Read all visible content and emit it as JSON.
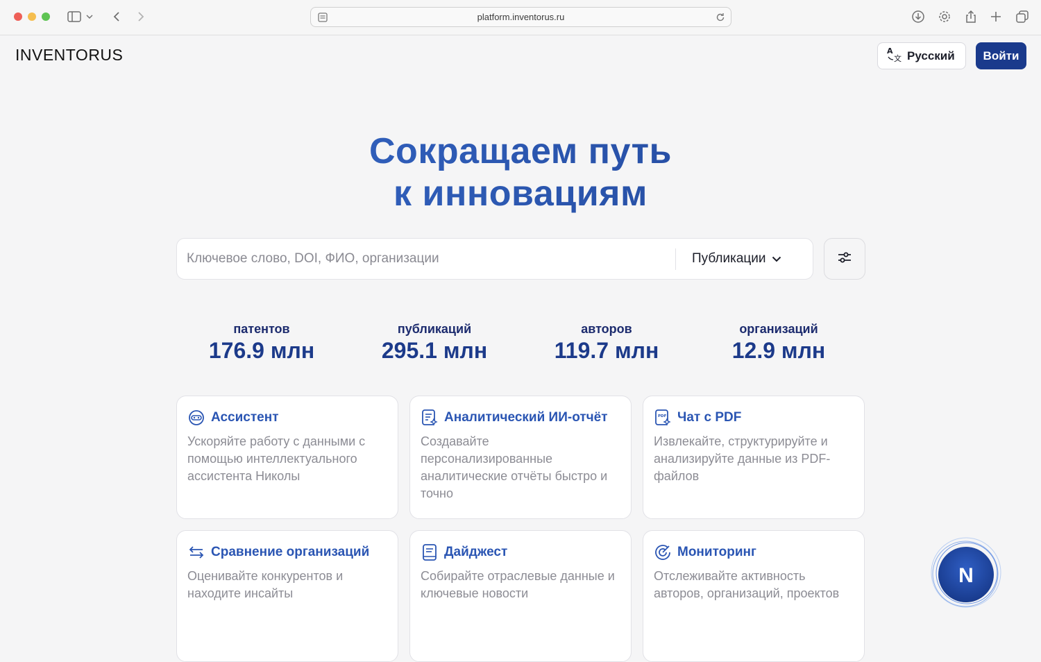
{
  "browser": {
    "url": "platform.inventorus.ru"
  },
  "header": {
    "logo": "INVENTORUS",
    "language_label": "Русский",
    "login_label": "Войти"
  },
  "hero": {
    "line1": "Сокращаем путь",
    "line2": "к инновациям"
  },
  "search": {
    "placeholder": "Ключевое слово, DOI, ФИО, организации",
    "category": "Публикации"
  },
  "stats": [
    {
      "label": "патентов",
      "value": "176.9 млн"
    },
    {
      "label": "публикаций",
      "value": "295.1 млн"
    },
    {
      "label": "авторов",
      "value": "119.7 млн"
    },
    {
      "label": "организаций",
      "value": "12.9 млн"
    }
  ],
  "cards": [
    {
      "title": "Ассистент",
      "icon": "assistant-icon",
      "description": "Ускоряйте работу с данными с помощью интеллектуального ассистента Николы"
    },
    {
      "title": "Аналитический ИИ-отчёт",
      "icon": "report-icon",
      "description": "Создавайте персонализированные аналитические отчёты быстро и точно"
    },
    {
      "title": "Чат с PDF",
      "icon": "pdf-icon",
      "description": "Извлекайте, структурируйте и анализируйте данные из PDF-файлов"
    },
    {
      "title": "Сравнение организаций",
      "icon": "compare-icon",
      "description": "Оценивайте конкурентов и находите инсайты"
    },
    {
      "title": "Дайджест",
      "icon": "digest-icon",
      "description": "Собирайте отраслевые данные и ключевые новости"
    },
    {
      "title": "Мониторинг",
      "icon": "monitoring-icon",
      "description": "Отслеживайте активность авторов, организаций, проектов"
    }
  ],
  "fab": {
    "letter": "N"
  },
  "colors": {
    "brand": "#1a3a8c",
    "accent": "#2a55b3"
  }
}
